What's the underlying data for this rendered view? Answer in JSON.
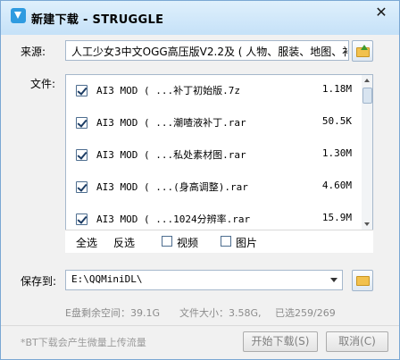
{
  "window": {
    "title": "新建下载 - STRUGGLE",
    "close_glyph": "✕"
  },
  "source": {
    "label": "来源:",
    "value": "人工少女3中文OGG高压版V2.2及 ( 人物、服装、地图、补"
  },
  "files": {
    "label": "文件:",
    "items": [
      {
        "name": "AI3 MOD ( ...补丁初始版.7z",
        "size": "1.18M",
        "checked": true
      },
      {
        "name": "AI3 MOD ( ...潮喳液补丁.rar",
        "size": "50.5K",
        "checked": true
      },
      {
        "name": "AI3 MOD ( ...私处素材图.rar",
        "size": "1.30M",
        "checked": true
      },
      {
        "name": "AI3 MOD ( ...(身高调整).rar",
        "size": "4.60M",
        "checked": true
      },
      {
        "name": "AI3 MOD ( ...1024分辨率.rar",
        "size": "15.9M",
        "checked": true
      }
    ],
    "select_all": "全选",
    "invert": "反选",
    "video": "视频",
    "image": "图片"
  },
  "save": {
    "label": "保存到:",
    "path": "E:\\QQMiniDL\\"
  },
  "info": {
    "free_space": "E盘剩余空间：39.1G",
    "file_size": "文件大小：3.58G,",
    "selected": "已选259/269"
  },
  "footer": {
    "note": "*BT下载会产生微量上传流量",
    "start_button": "开始下载(S)",
    "cancel_button": "取消(C)"
  },
  "colors": {
    "window_border": "#7aa7d3",
    "accent_blue": "#2f9be0",
    "folder_yellow": "#f2c14e",
    "disabled_text": "#808080"
  },
  "icons": {
    "app": "download-arrow-icon",
    "close": "close-icon",
    "open_folder": "folder-up-icon",
    "browse": "folder-icon",
    "dropdown": "chevron-down-icon"
  }
}
